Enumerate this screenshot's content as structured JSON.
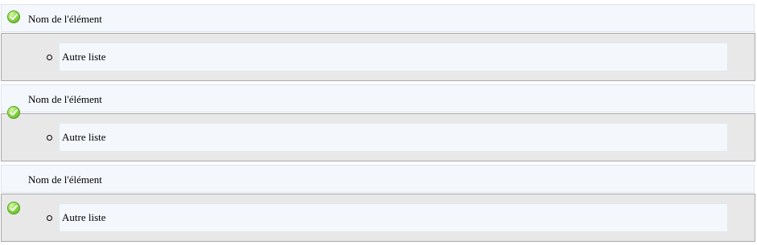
{
  "items": [
    {
      "label": "Nom de l'élément",
      "children": [
        {
          "label": "Autre liste"
        }
      ],
      "icon": "check-icon",
      "icon_color": "#6cc02f"
    },
    {
      "label": "Nom de l'élément",
      "children": [
        {
          "label": "Autre liste"
        }
      ],
      "icon": "check-icon",
      "icon_color": "#6cc02f"
    },
    {
      "label": "Nom de l'élément",
      "children": [
        {
          "label": "Autre liste"
        }
      ],
      "icon": "check-icon",
      "icon_color": "#6cc02f"
    }
  ],
  "colors": {
    "header_bg": "#f4f7fc",
    "sublist_bg": "#e8e8e8",
    "sublist_border": "#a9a9a9"
  }
}
